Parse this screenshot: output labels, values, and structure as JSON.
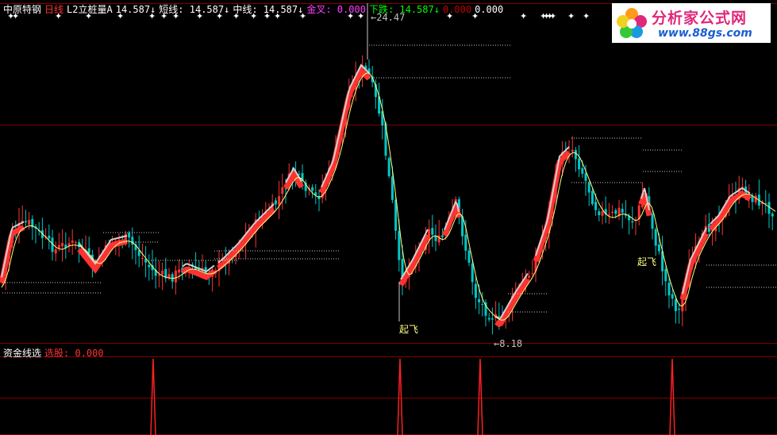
{
  "header": {
    "stock_name": "中原特钢",
    "period": "日线",
    "indicator": "L2立桩量A",
    "values": [
      {
        "text": "14.587↓",
        "color": "#ffffff"
      },
      {
        "text": "短线: 14.587↓",
        "color": "#ffffff"
      },
      {
        "text": "中线: 14.587↓",
        "color": "#ffffff"
      },
      {
        "text": "金叉: 0.000",
        "color": "#ff40ff"
      },
      {
        "text": "下跌: 14.587↓",
        "color": "#00ff00"
      },
      {
        "text": "0.000",
        "color": "#c00000"
      },
      {
        "text": "0.000",
        "color": "#ffffff"
      }
    ]
  },
  "sub_header": {
    "title": "资金线选",
    "label": "选股: 0.000"
  },
  "logo": {
    "title": "分析家公式网",
    "url": "www.88gs.com"
  },
  "annotations": {
    "high": "←24.47",
    "low": "←8.18",
    "signals": [
      "起飞",
      "起飞"
    ]
  },
  "colors": {
    "up": "#ff3232",
    "down": "#00c8c8",
    "ma": "#ffff80",
    "grid": "#800000",
    "dots": "#ffffff"
  },
  "chart_data": {
    "type": "candlestick",
    "y_max": 24.47,
    "y_min": 8.18,
    "sub_signal_indices": [
      33,
      85,
      102,
      144
    ]
  }
}
